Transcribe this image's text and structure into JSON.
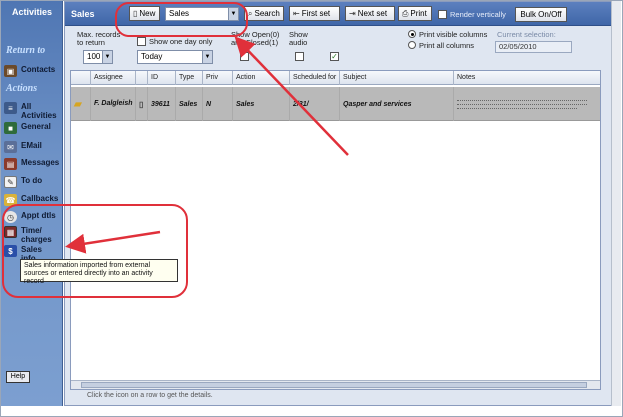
{
  "sidebar": {
    "title": "Activities",
    "return_to": "Return to",
    "actions": "Actions",
    "items": [
      {
        "label": "Contacts",
        "icon": "contacts-icon"
      },
      {
        "label": "All Activities",
        "icon": "all-activities-icon"
      },
      {
        "label": "General",
        "icon": "general-icon"
      },
      {
        "label": "EMail",
        "icon": "email-icon"
      },
      {
        "label": "Messages",
        "icon": "messages-icon"
      },
      {
        "label": "To do",
        "icon": "todo-icon"
      },
      {
        "label": "Callbacks",
        "icon": "callbacks-icon"
      },
      {
        "label": "Appt dtls",
        "icon": "appointment-icon"
      },
      {
        "label": "Time/ charges",
        "icon": "time-charges-icon"
      },
      {
        "label": "Sales info",
        "icon": "sales-icon"
      }
    ],
    "help_label": "Help"
  },
  "toolbar": {
    "title": "Sales",
    "new_label": "New",
    "type_select": "Sales",
    "search_label": "Search",
    "first_set_label": "First set",
    "next_set_label": "Next set",
    "print_label": "Print",
    "render_vertically_label": "Render vertically",
    "bulk_label": "Bulk On/Off"
  },
  "filters": {
    "max_records_label": "Max. records to return",
    "max_records_value": "100",
    "one_day_label": "Show one day only",
    "day_value": "Today",
    "open_closed_label": "Show Open(0) and Closed(1)",
    "show_audio_label": "Show audio",
    "print_visible_label": "Print visible columns",
    "print_all_label": "Print all columns",
    "current_selection_label": "Current selection:",
    "current_selection_value": "02/05/2010"
  },
  "table": {
    "headers": [
      "Assignee",
      "ID",
      "Type",
      "Priv",
      "Action",
      "Scheduled for",
      "Subject",
      "Notes"
    ],
    "rows": [
      {
        "assignee": "F. Dalgleish",
        "id": "39611",
        "type": "Sales",
        "priv": "N",
        "action": "Sales",
        "scheduled": "2/31/",
        "subject": "Qasper and services",
        "notes": ""
      }
    ]
  },
  "footnote": "Click the icon on a row to get the details.",
  "tooltip": "Sales information imported from external sources or entered directly into an activity record",
  "colors": {
    "sidebar": "#5f85c2",
    "toolbar": "#4a70b2",
    "annotation": "#e0303a",
    "row": "#b9b9b9"
  }
}
